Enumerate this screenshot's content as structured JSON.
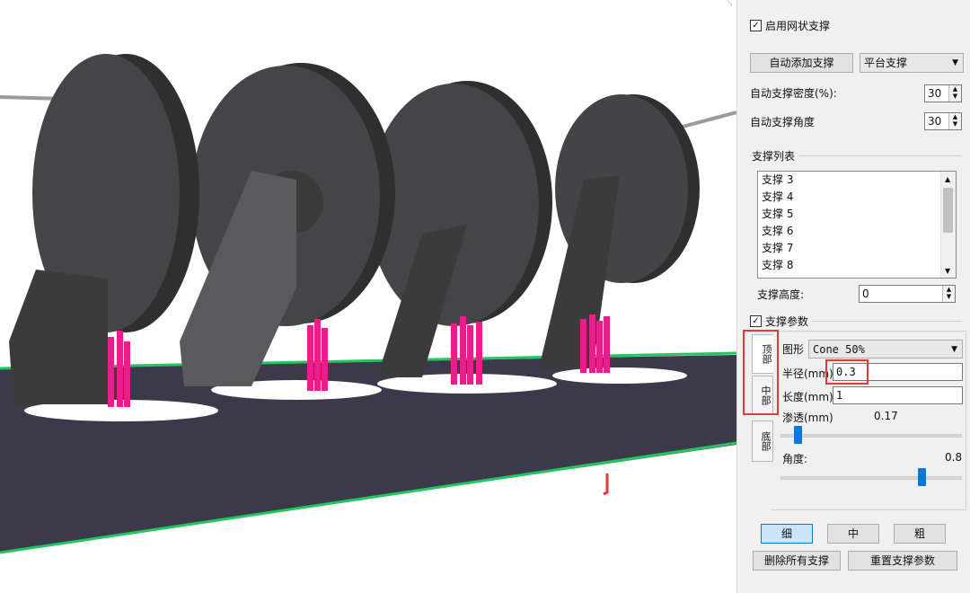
{
  "panel": {
    "enable_mesh_support": {
      "label": "启用网状支撑",
      "checked": true
    },
    "auto_add_button": "自动添加支撑",
    "support_type": {
      "selected": "平台支撑"
    },
    "density": {
      "label": "自动支撑密度(%):",
      "value": "30"
    },
    "angle": {
      "label": "自动支撑角度",
      "value": "30"
    },
    "support_list": {
      "title": "支撑列表",
      "items": [
        "支撑 3",
        "支撑 4",
        "支撑 5",
        "支撑 6",
        "支撑 7",
        "支撑 8"
      ]
    },
    "support_height": {
      "label": "支撑高度:",
      "value": "0"
    },
    "support_params": {
      "label": "支撑参数",
      "checked": true
    },
    "tabs": [
      "顶部",
      "中部",
      "底部"
    ],
    "shape": {
      "label": "图形",
      "selected": "Cone 50%"
    },
    "radius": {
      "label": "半径(mm)",
      "value": "0.3"
    },
    "length": {
      "label": "长度(mm)",
      "value": "1"
    },
    "penetration": {
      "label": "渗透(mm)",
      "value": "0.17",
      "level": 0.08
    },
    "angle_param": {
      "label": "角度:",
      "value": "0.8",
      "level": 0.8
    },
    "size_buttons": [
      "细",
      "中",
      "粗"
    ],
    "delete_all_button": "删除所有支撑",
    "reset_params_button": "重置支撑参数"
  },
  "colors": {
    "platform": "#3c3a4a",
    "platform_edge": "#22c55e",
    "model": "#3f3f40",
    "supports": "#e91e8c",
    "highlight": "#e53935",
    "slider_thumb": "#0a78d7"
  }
}
